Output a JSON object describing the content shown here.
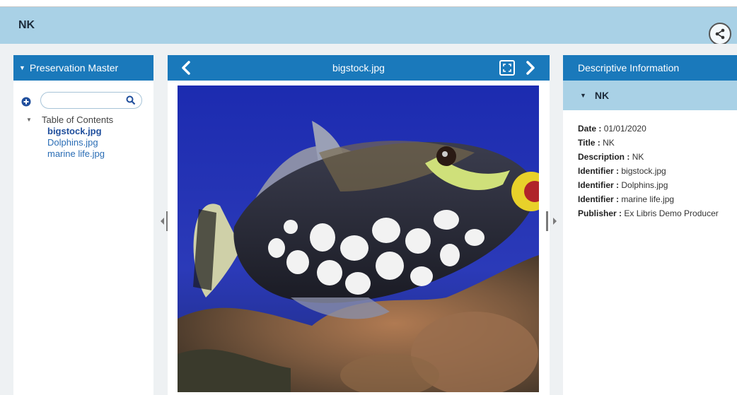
{
  "header": {
    "title": "NK"
  },
  "icons": {
    "share": "share-icon",
    "add": "plus-circle-icon",
    "search": "search-icon",
    "prev": "chevron-left-icon",
    "next": "chevron-right-icon",
    "fullscreen": "fullscreen-icon"
  },
  "colors": {
    "header_bg": "#a9d1e6",
    "panel_head_bg": "#1a79bb",
    "link": "#2a6db5"
  },
  "left_panel": {
    "title": "Preservation Master",
    "search": {
      "value": "",
      "placeholder": ""
    },
    "toc": {
      "title": "Table of Contents",
      "items": [
        {
          "label": "bigstock.jpg",
          "selected": true
        },
        {
          "label": "Dolphins.jpg",
          "selected": false
        },
        {
          "label": "marine life.jpg",
          "selected": false
        }
      ]
    }
  },
  "viewer": {
    "file_title": "bigstock.jpg"
  },
  "right_panel": {
    "title": "Descriptive Information",
    "section_title": "NK",
    "fields": [
      {
        "key": "Date :",
        "value": "01/01/2020"
      },
      {
        "key": "Title :",
        "value": "NK"
      },
      {
        "key": "Description :",
        "value": "NK"
      },
      {
        "key": "Identifier :",
        "value": "bigstock.jpg"
      },
      {
        "key": "Identifier :",
        "value": "Dolphins.jpg"
      },
      {
        "key": "Identifier :",
        "value": "marine life.jpg"
      },
      {
        "key": "Publisher :",
        "value": "Ex Libris Demo Producer"
      }
    ]
  }
}
